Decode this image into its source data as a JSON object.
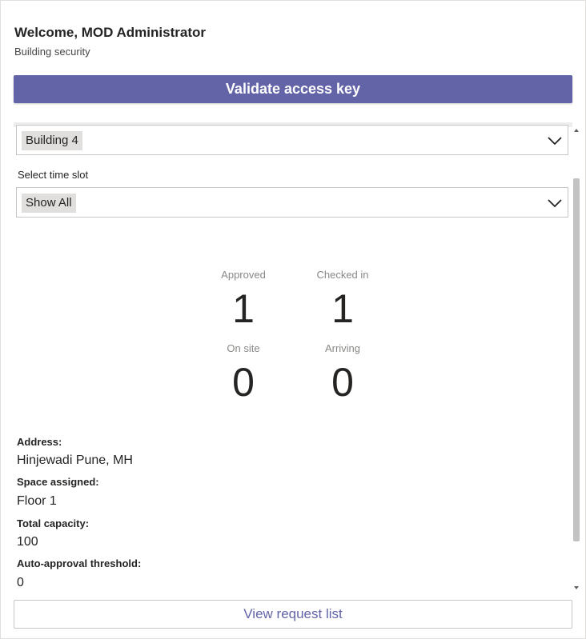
{
  "header": {
    "welcome": "Welcome, MOD Administrator",
    "subtitle": "Building security"
  },
  "validate_button": {
    "label": "Validate access key"
  },
  "building_select": {
    "value": "Building 4",
    "icon": "chevron-down-icon"
  },
  "time_slot": {
    "label": "Select time slot",
    "value": "Show All",
    "icon": "chevron-down-icon"
  },
  "stats": {
    "approved": {
      "label": "Approved",
      "value": "1"
    },
    "checked_in": {
      "label": "Checked in",
      "value": "1"
    },
    "on_site": {
      "label": "On site",
      "value": "0"
    },
    "arriving": {
      "label": "Arriving",
      "value": "0"
    }
  },
  "details": {
    "address_label": "Address:",
    "address_value": "Hinjewadi Pune, MH",
    "space_label": "Space assigned:",
    "space_value": "Floor 1",
    "capacity_label": "Total capacity:",
    "capacity_value": "100",
    "threshold_label": "Auto-approval threshold:",
    "threshold_value": "0"
  },
  "view_button": {
    "label": "View request list"
  },
  "colors": {
    "accent": "#6264a7",
    "text": "#252423",
    "muted": "#8a8886"
  }
}
